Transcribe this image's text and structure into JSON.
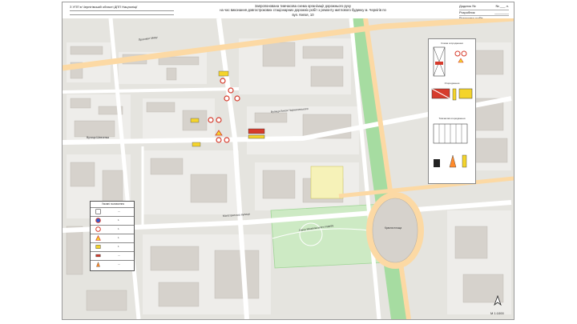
{
  "header": {
    "left_text": "З УПП в Чернігівській області ДПП Нацполіції",
    "title_lines": [
      "Запропонована тимчасова схема організації дорожнього руху",
      "на час виконання довгострокових стаціонарних дорожніх робіт з ремонту житлового будинку м. Чернігів по",
      "вул. Князя, 10"
    ],
    "right_rows": [
      {
        "label": "Додаток №",
        "value": "№ ___ л."
      },
      {
        "label": "Розробник",
        "value": "________"
      },
      {
        "label": "Розпочато робіт",
        "value": "________"
      },
      {
        "label": "Закінчення робіт",
        "value": "________"
      }
    ]
  },
  "map": {
    "street_labels": [
      {
        "text": "Проспект Миру",
        "name": "label-prospekt-myru"
      },
      {
        "text": "Вулиця Шевченка",
        "name": "label-shevchenka"
      },
      {
        "text": "Магістратська вулиця",
        "name": "label-mahistratska"
      },
      {
        "text": "Вулиця Князя Чорниговського",
        "name": "label-kniazia"
      },
      {
        "text": "Сквер Міхайлівського подвіру",
        "name": "label-skver"
      },
      {
        "text": "Красна площа",
        "name": "label-krasna-ploshcha"
      }
    ],
    "colors": {
      "land": "#e5e4df",
      "block": "#eeedea",
      "building": "#d6d2cc",
      "road": "#ffffff",
      "park": "#cdeac4",
      "main_road": "#fcd9a4",
      "green_strip": "#a6dca1",
      "yellow_area": "#f6f2b8",
      "sign_red": "#d63b2c",
      "sign_yellow": "#f4d42c"
    }
  },
  "legend": {
    "title": "Умовні позначення",
    "rows": [
      {
        "icon": "zone-sign-icon",
        "value": "—"
      },
      {
        "icon": "no-stopping-sign-icon",
        "value": "1"
      },
      {
        "icon": "speed-limit-sign-icon",
        "value": "1"
      },
      {
        "icon": "road-works-sign-icon",
        "value": "1"
      },
      {
        "icon": "barrier-yellow-icon",
        "value": "1"
      },
      {
        "icon": "fence-icon",
        "value": "—"
      },
      {
        "icon": "cone-icon",
        "value": "—"
      }
    ]
  },
  "detail_panel": {
    "caption_top": "Схема огородження",
    "caption_mid": "Огородження",
    "caption_low": "Тимчасові огородження"
  },
  "scale": {
    "text": "М 1:1000"
  }
}
